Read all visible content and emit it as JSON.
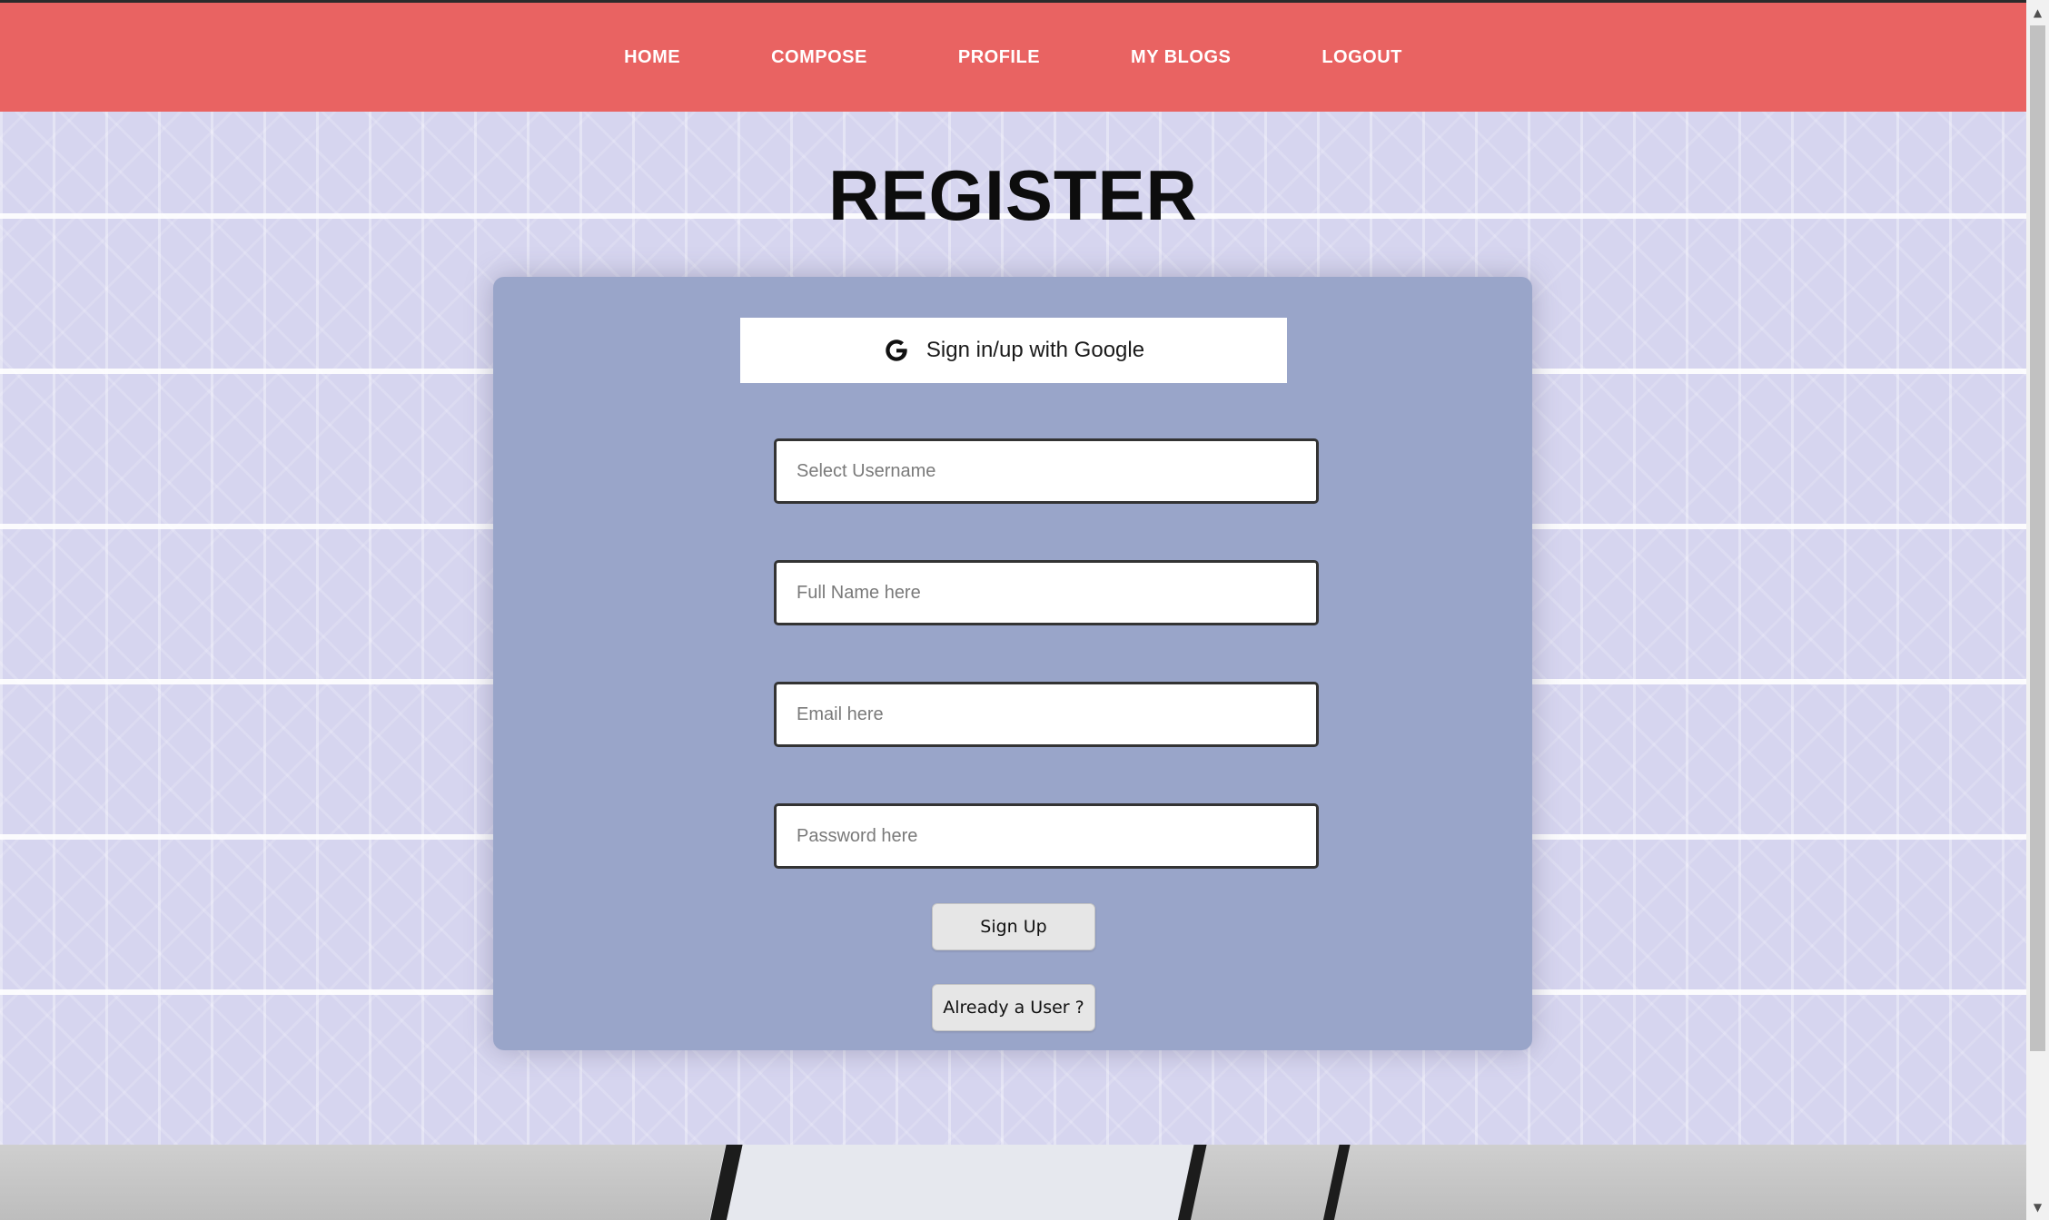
{
  "nav": {
    "items": [
      {
        "label": "HOME"
      },
      {
        "label": "COMPOSE"
      },
      {
        "label": "PROFILE"
      },
      {
        "label": "MY BLOGS"
      },
      {
        "label": "LOGOUT"
      }
    ]
  },
  "page": {
    "title": "REGISTER"
  },
  "form": {
    "google_label": "Sign in/up with Google",
    "username_placeholder": "Select Username",
    "fullname_placeholder": "Full Name here",
    "email_placeholder": "Email here",
    "password_placeholder": "Password here",
    "signup_label": "Sign Up",
    "already_user_label": "Already a User ?"
  },
  "colors": {
    "nav_bg": "#e96362",
    "card_bg": "#99a5c9",
    "pattern_bg": "#d6d5ef"
  },
  "icons": {
    "google": "google-g-icon",
    "scroll_up": "scroll-up-arrow-icon",
    "scroll_down": "scroll-down-arrow-icon"
  }
}
